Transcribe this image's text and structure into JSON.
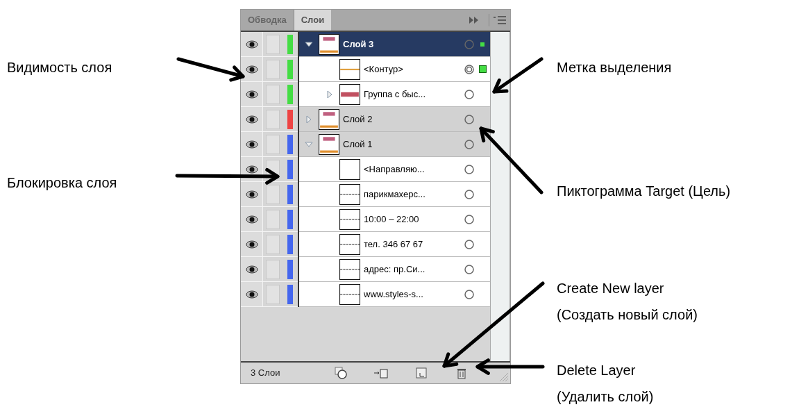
{
  "tabs": [
    {
      "label": "Обводка",
      "selected": false
    },
    {
      "label": "Слои",
      "selected": true
    }
  ],
  "layers": [
    {
      "name": "Слой 3",
      "kind": "layer",
      "color": "#44dd44",
      "visible": true,
      "locked": false,
      "selected": true,
      "expanded": true,
      "targeted": false,
      "selection_marked": true,
      "children": [
        {
          "name": "<Контур>",
          "kind": "path",
          "visible": true,
          "locked": false,
          "selected": false,
          "targeted": true,
          "selection_marked": true
        },
        {
          "name": "Группа с быс...",
          "kind": "group",
          "visible": true,
          "locked": false,
          "selected": false,
          "expanded": false,
          "targeted": false,
          "selection_marked": false
        }
      ]
    },
    {
      "name": "Слой 2",
      "kind": "layer",
      "color": "#ee4444",
      "visible": true,
      "locked": false,
      "selected": false,
      "expanded": false,
      "targeted": false,
      "selection_marked": false
    },
    {
      "name": "Слой 1",
      "kind": "layer",
      "color": "#4466ee",
      "visible": true,
      "locked": false,
      "selected": false,
      "expanded": true,
      "targeted": false,
      "selection_marked": false,
      "children": [
        {
          "name": "<Направляю...",
          "kind": "guide",
          "visible": true,
          "locked": false,
          "selected": false,
          "targeted": false,
          "selection_marked": false
        },
        {
          "name": "парикмахерс...",
          "kind": "text",
          "visible": true,
          "locked": false,
          "selected": false,
          "targeted": false,
          "selection_marked": false
        },
        {
          "name": "10:00 – 22:00",
          "kind": "text",
          "visible": true,
          "locked": false,
          "selected": false,
          "targeted": false,
          "selection_marked": false
        },
        {
          "name": "тел. 346 67 67",
          "kind": "text",
          "visible": true,
          "locked": false,
          "selected": false,
          "targeted": false,
          "selection_marked": false
        },
        {
          "name": "адрес: пр.Си...",
          "kind": "text",
          "visible": true,
          "locked": false,
          "selected": false,
          "targeted": false,
          "selection_marked": false
        },
        {
          "name": "www.styles-s...",
          "kind": "text",
          "visible": true,
          "locked": false,
          "selected": false,
          "targeted": false,
          "selection_marked": false
        }
      ]
    }
  ],
  "footer": {
    "count": "3 Слои"
  },
  "annotations": [
    {
      "lines": [
        "Видимость слоя"
      ]
    },
    {
      "lines": [
        "Блокировка слоя"
      ]
    },
    {
      "lines": [
        "Метка выделения"
      ]
    },
    {
      "lines": [
        "Пиктограмма Target (Цель)"
      ]
    },
    {
      "lines": [
        "Create New layer",
        "(Создать новый слой)"
      ]
    },
    {
      "lines": [
        "Delete Layer",
        "(Удалить слой)"
      ]
    }
  ]
}
